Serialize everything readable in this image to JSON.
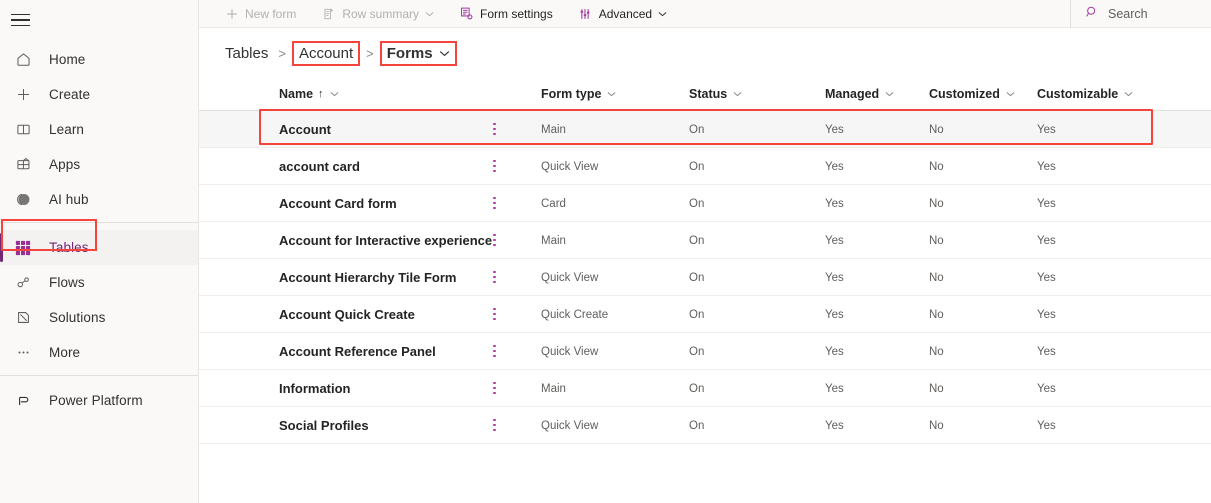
{
  "sidebar": {
    "menu_icon": "hamburger-icon",
    "groups": [
      {
        "items": [
          {
            "label": "Home",
            "icon": "home-icon",
            "active": false
          },
          {
            "label": "Create",
            "icon": "plus-icon",
            "active": false
          },
          {
            "label": "Learn",
            "icon": "book-icon",
            "active": false
          },
          {
            "label": "Apps",
            "icon": "apps-icon",
            "active": false
          },
          {
            "label": "AI hub",
            "icon": "ai-hub-icon",
            "active": false
          }
        ]
      },
      {
        "items": [
          {
            "label": "Tables",
            "icon": "table-grid-icon",
            "active": true
          },
          {
            "label": "Flows",
            "icon": "flows-icon",
            "active": false
          },
          {
            "label": "Solutions",
            "icon": "solutions-icon",
            "active": false
          },
          {
            "label": "More",
            "icon": "ellipsis-icon",
            "active": false
          }
        ]
      },
      {
        "items": [
          {
            "label": "Power Platform",
            "icon": "power-platform-icon",
            "active": false
          }
        ]
      }
    ],
    "highlight_color": "#f5443c",
    "active_color": "#742774"
  },
  "toolbar": {
    "items": [
      {
        "label": "New form",
        "icon": "plus-icon",
        "disabled": true,
        "has_chevron": false
      },
      {
        "label": "Row summary",
        "icon": "row-summary-icon",
        "disabled": true,
        "has_chevron": true
      },
      {
        "label": "Form settings",
        "icon": "form-settings-icon",
        "disabled": false,
        "has_chevron": false
      },
      {
        "label": "Advanced",
        "icon": "advanced-icon",
        "disabled": false,
        "has_chevron": true
      }
    ],
    "search": {
      "label": "Search",
      "icon": "search-icon"
    }
  },
  "breadcrumb": {
    "root": "Tables",
    "separator": ">",
    "table": "Account",
    "current": "Forms",
    "chevron_icon": "chevron-down-icon"
  },
  "table": {
    "columns": [
      {
        "key": "name",
        "label": "Name",
        "sorted": "asc",
        "sort_glyph": "↑"
      },
      {
        "key": "kebab",
        "label": ""
      },
      {
        "key": "form_type",
        "label": "Form type"
      },
      {
        "key": "status",
        "label": "Status"
      },
      {
        "key": "managed",
        "label": "Managed"
      },
      {
        "key": "customized",
        "label": "Customized"
      },
      {
        "key": "customizable",
        "label": "Customizable"
      }
    ],
    "rows": [
      {
        "name": "Account",
        "form_type": "Main",
        "status": "On",
        "managed": "Yes",
        "customized": "No",
        "customizable": "Yes",
        "selected": true,
        "annotated": true
      },
      {
        "name": "account card",
        "form_type": "Quick View",
        "status": "On",
        "managed": "Yes",
        "customized": "No",
        "customizable": "Yes",
        "selected": false,
        "annotated": false
      },
      {
        "name": "Account Card form",
        "form_type": "Card",
        "status": "On",
        "managed": "Yes",
        "customized": "No",
        "customizable": "Yes",
        "selected": false,
        "annotated": false
      },
      {
        "name": "Account for Interactive experience",
        "form_type": "Main",
        "status": "On",
        "managed": "Yes",
        "customized": "No",
        "customizable": "Yes",
        "selected": false,
        "annotated": false
      },
      {
        "name": "Account Hierarchy Tile Form",
        "form_type": "Quick View",
        "status": "On",
        "managed": "Yes",
        "customized": "No",
        "customizable": "Yes",
        "selected": false,
        "annotated": false
      },
      {
        "name": "Account Quick Create",
        "form_type": "Quick Create",
        "status": "On",
        "managed": "Yes",
        "customized": "No",
        "customizable": "Yes",
        "selected": false,
        "annotated": false
      },
      {
        "name": "Account Reference Panel",
        "form_type": "Quick View",
        "status": "On",
        "managed": "Yes",
        "customized": "No",
        "customizable": "Yes",
        "selected": false,
        "annotated": false
      },
      {
        "name": "Information",
        "form_type": "Main",
        "status": "On",
        "managed": "Yes",
        "customized": "No",
        "customizable": "Yes",
        "selected": false,
        "annotated": false
      },
      {
        "name": "Social Profiles",
        "form_type": "Quick View",
        "status": "On",
        "managed": "Yes",
        "customized": "No",
        "customizable": "Yes",
        "selected": false,
        "annotated": false
      }
    ],
    "kebab_icon": "more-vertical-icon",
    "kebab_color": "#b4399e"
  }
}
